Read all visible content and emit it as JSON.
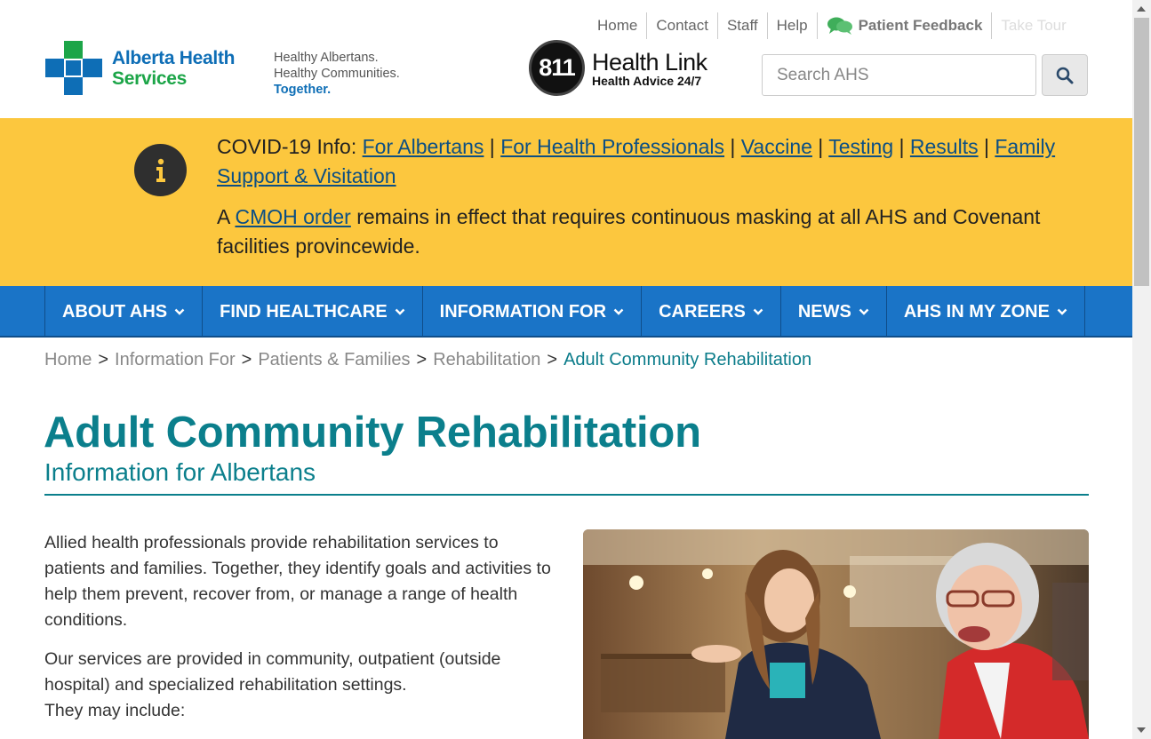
{
  "util_nav": {
    "home": "Home",
    "contact": "Contact",
    "staff": "Staff",
    "help": "Help",
    "feedback": "Patient Feedback",
    "hidden_item": "Take Tour"
  },
  "logo": {
    "line1": "Alberta Health",
    "line2": "Services"
  },
  "tagline": {
    "line1": "Healthy Albertans.",
    "line2": "Healthy Communities.",
    "line3": "Together."
  },
  "healthlink": {
    "badge": "811",
    "title": "Health Link",
    "subtitle": "Health Advice 24/7"
  },
  "search": {
    "placeholder": "Search AHS"
  },
  "banner": {
    "covid_prefix": "COVID-19 Info: ",
    "links": [
      "For Albertans",
      "For Health Professionals",
      "Vaccine",
      "Testing",
      "Results",
      "Family Support & Visitation"
    ],
    "separator": " | ",
    "masking_prefix": "A ",
    "masking_link": "CMOH order",
    "masking_suffix": " remains in effect that requires continuous masking at all AHS and Covenant facilities provincewide."
  },
  "main_nav": [
    "ABOUT AHS",
    "FIND HEALTHCARE",
    "INFORMATION FOR",
    "CAREERS",
    "NEWS",
    "AHS IN MY ZONE"
  ],
  "breadcrumb": {
    "items": [
      "Home",
      "Information For",
      "Patients & Families",
      "Rehabilitation"
    ],
    "current": "Adult Community Rehabilitation",
    "separator": ">"
  },
  "page": {
    "title": "Adult Community Rehabilitation",
    "subtitle": "Information for Albertans"
  },
  "content": {
    "para1": "Allied health professionals provide rehabilitation services to patients and families. Together, they identify goals and activities to help them prevent, recover from, or manage a range of health conditions.",
    "para2_line1": "Our services are provided in community, outpatient (outside hospital) and specialized rehabilitation settings.",
    "para2_line2": "They may include:"
  },
  "colors": {
    "teal": "#0b7f8c",
    "nav_blue": "#1a74c7",
    "banner_yellow": "#fcc73e",
    "ahs_blue": "#0e6eb6",
    "ahs_green": "#1ca548"
  }
}
